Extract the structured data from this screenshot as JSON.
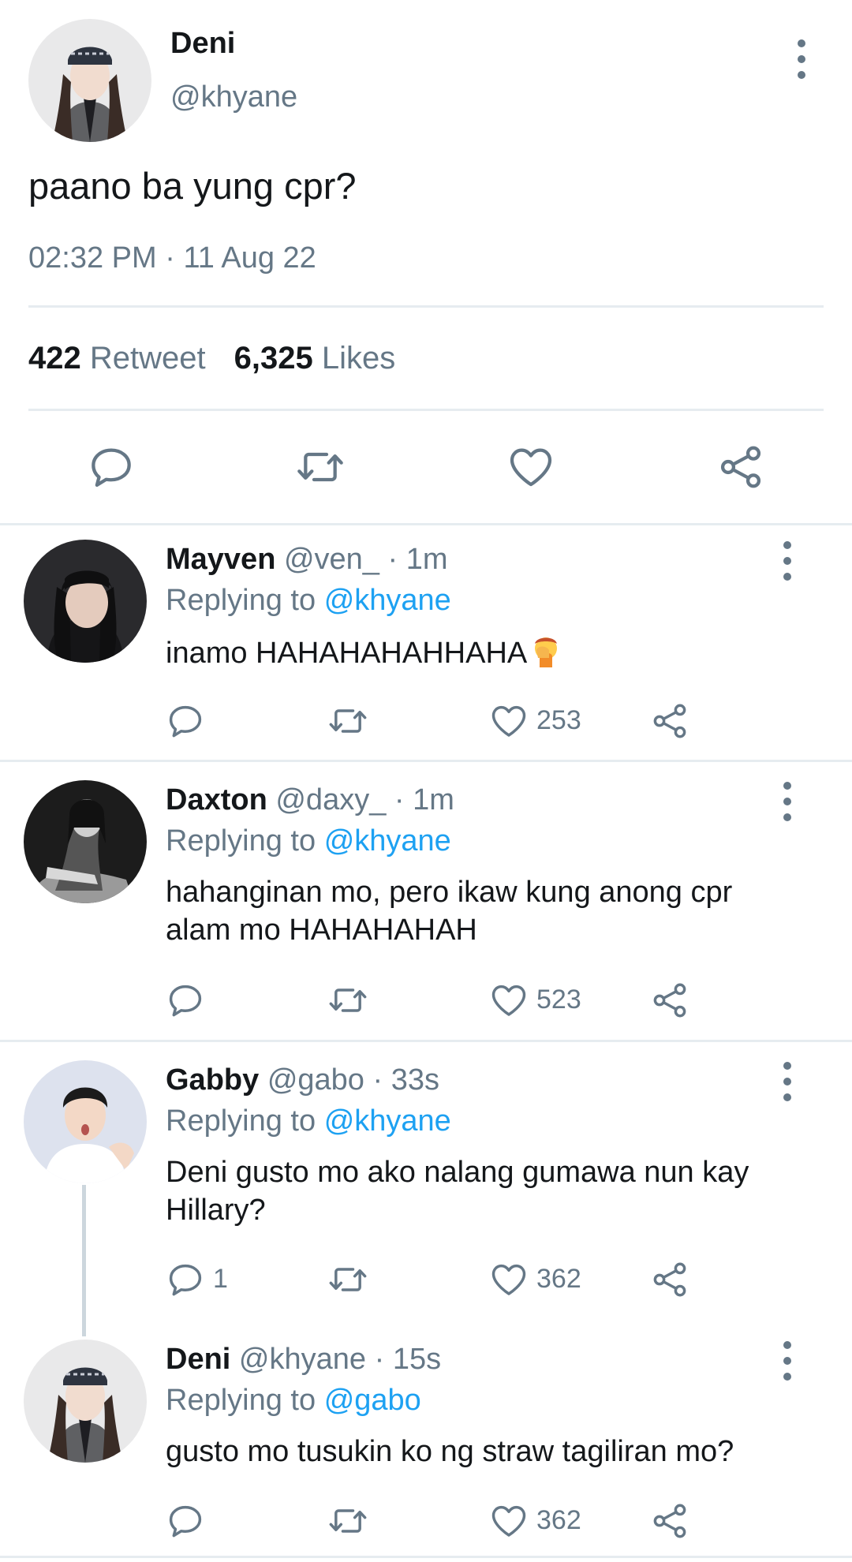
{
  "main_tweet": {
    "name": "Deni",
    "handle": "@khyane",
    "text": "paano ba yung cpr?",
    "time": "02:32 PM",
    "separator": "·",
    "date": "11 Aug 22",
    "retweet_count": "422",
    "retweet_label": "Retweet",
    "likes_count": "6,325",
    "likes_label": "Likes"
  },
  "icons": {
    "reply": "reply-bubble-icon",
    "retweet": "retweet-arrows-icon",
    "like": "heart-icon",
    "share": "share-icon",
    "more": "more-vertical-icon",
    "facepalm": "facepalm-emoji"
  },
  "colors": {
    "accent": "#1da1f2",
    "secondary_text": "#657786",
    "primary_text": "#14171a",
    "divider": "#e6ecf0"
  },
  "replies": [
    {
      "name": "Mayven",
      "handle": "@ven_",
      "time": "· 1m",
      "replying_prefix": "Replying to",
      "replying_to": "@khyane",
      "text": "inamo HAHAHAHAHHAHA",
      "reply_count": "",
      "likes": "253"
    },
    {
      "name": "Daxton",
      "handle": "@daxy_",
      "time": "· 1m",
      "replying_prefix": "Replying to",
      "replying_to": "@khyane",
      "text": "hahanginan mo, pero ikaw kung anong cpr alam mo HAHAHAHAH",
      "reply_count": "",
      "likes": "523"
    },
    {
      "name": "Gabby",
      "handle": "@gabo",
      "time": "· 33s",
      "replying_prefix": "Replying to",
      "replying_to": "@khyane",
      "text": "Deni gusto mo ako nalang gumawa nun kay Hillary?",
      "reply_count": "1",
      "likes": "362"
    },
    {
      "name": "Deni",
      "handle": "@khyane",
      "time": "· 15s",
      "replying_prefix": "Replying to",
      "replying_to": "@gabo",
      "text": "gusto mo tusukin ko ng straw tagiliran mo?",
      "reply_count": "",
      "likes": "362"
    }
  ]
}
